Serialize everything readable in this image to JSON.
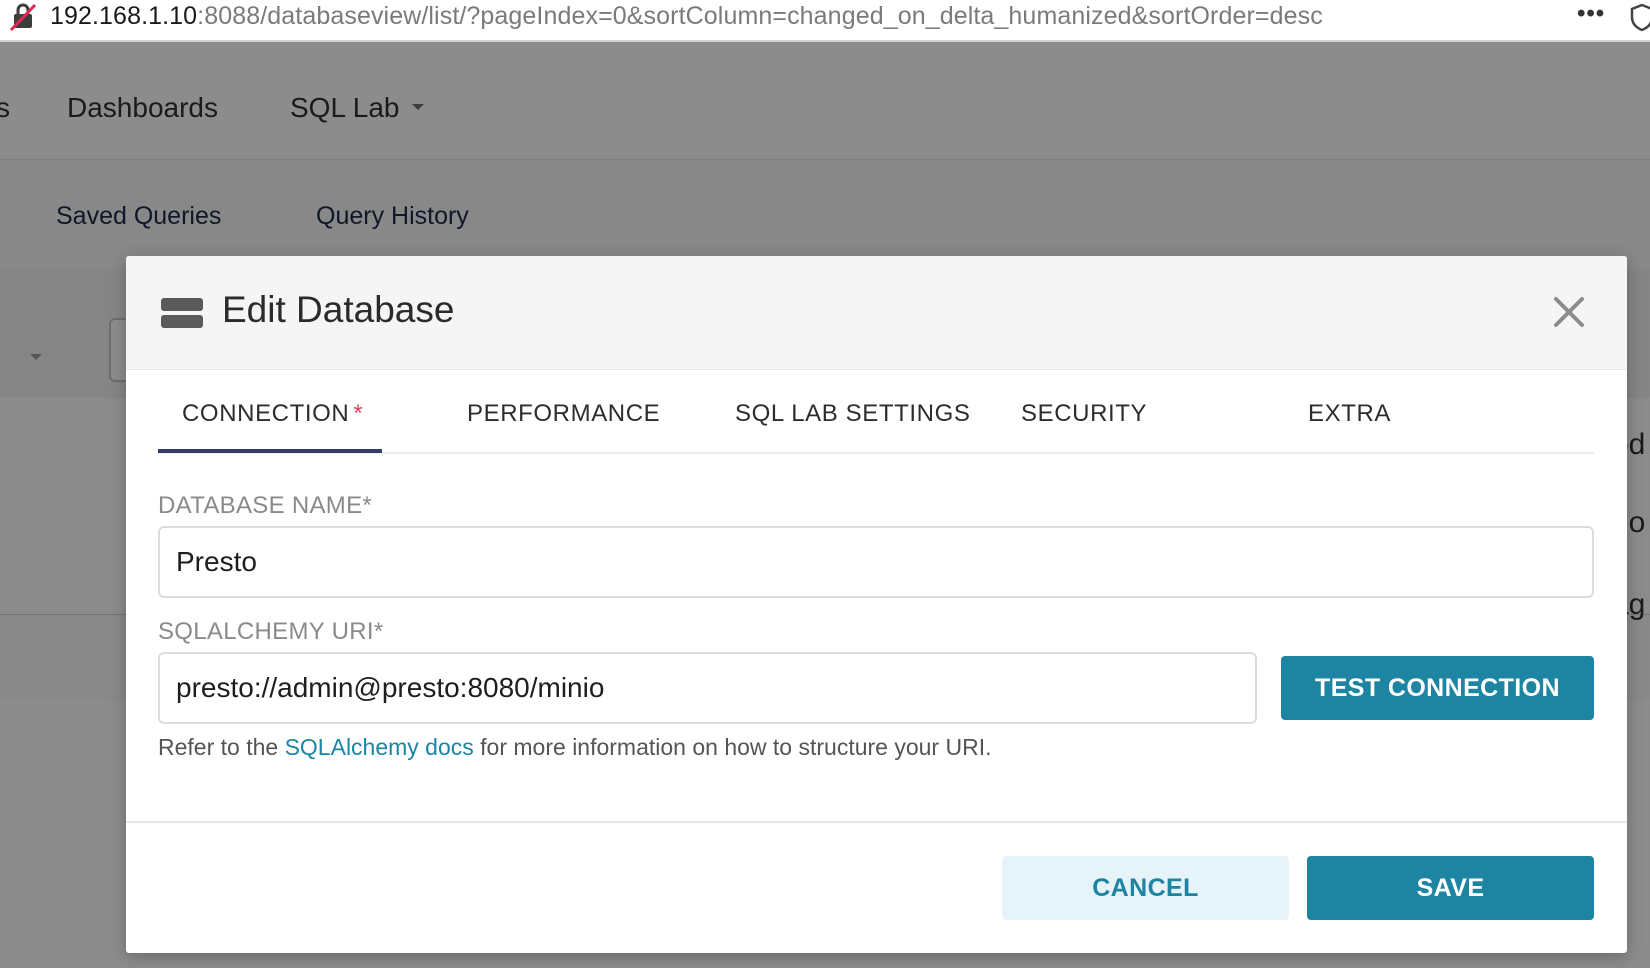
{
  "browser": {
    "url_host": "192.168.1.10",
    "url_rest": ":8088/databaseview/list/?pageIndex=0&sortColumn=changed_on_delta_humanized&sortOrder=desc",
    "more_label": "•••",
    "lock_icon": "insecure-lock-icon",
    "shield_icon": "shield-icon"
  },
  "app": {
    "nav": {
      "cut_item": "s",
      "dashboards": "Dashboards",
      "sql_lab": "SQL Lab"
    },
    "subnav": {
      "saved_queries": "Saved Queries",
      "query_history": "Query History"
    },
    "table_peek": [
      "od",
      "go",
      "ag"
    ]
  },
  "modal": {
    "title": "Edit Database",
    "icon": "database-icon",
    "tabs": [
      {
        "label": "CONNECTION",
        "required": "*",
        "active": true
      },
      {
        "label": "PERFORMANCE"
      },
      {
        "label": "SQL LAB SETTINGS"
      },
      {
        "label": "SECURITY"
      },
      {
        "label": "EXTRA"
      }
    ],
    "fields": {
      "database_name": {
        "label": "DATABASE NAME*",
        "value": "Presto"
      },
      "sqlalchemy_uri": {
        "label": "SQLALCHEMY URI*",
        "value": "presto://admin@presto:8080/minio"
      }
    },
    "test_connection_label": "TEST CONNECTION",
    "helper": {
      "prefix": "Refer to the ",
      "link": "SQLAlchemy docs",
      "suffix": " for more information on how to structure your URI."
    },
    "cancel_label": "CANCEL",
    "save_label": "SAVE"
  },
  "colors": {
    "primary": "#1d84a2",
    "primary_light": "#e6f4f9",
    "tab_active_underline": "#323e66",
    "required_mark": "#e04355",
    "overlay": "rgba(0,0,0,0.45)"
  }
}
